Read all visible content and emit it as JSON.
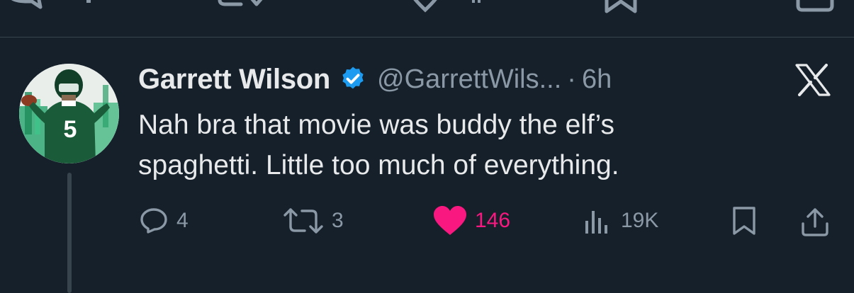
{
  "tweet": {
    "author_name": "Garrett Wilson",
    "handle": "@GarrettWils...",
    "separator": "·",
    "time": "6h",
    "text": "Nah bra that movie was buddy the elf’s\nspaghetti. Little too much of everything.",
    "avatar_jersey_number": "5"
  },
  "actions": {
    "reply_count": "4",
    "retweet_count": "3",
    "like_count": "146",
    "views_count": "19K"
  },
  "colors": {
    "background": "#15202b",
    "primary_text": "#e7e9ea",
    "secondary_text": "#8b98a5",
    "verified_blue": "#1d9bf0",
    "like_pink": "#f91880",
    "divider": "#38444d"
  },
  "icons": [
    "reply-icon",
    "retweet-icon",
    "heart-icon",
    "views-icon",
    "bookmark-icon",
    "share-icon",
    "verified-badge-icon",
    "x-logo-icon"
  ]
}
